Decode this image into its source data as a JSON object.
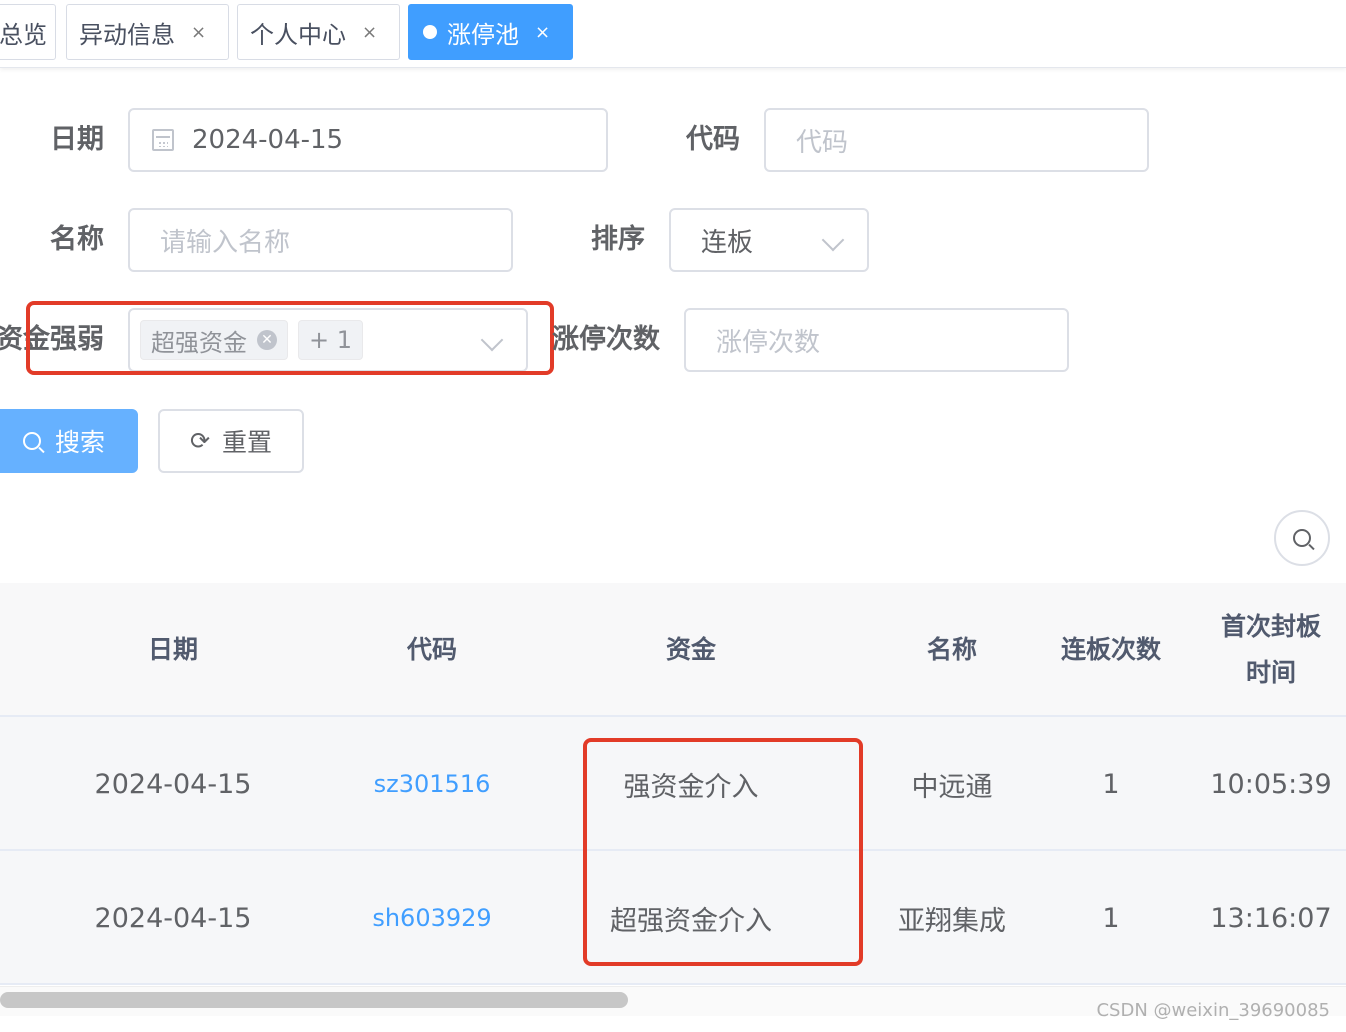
{
  "tabs": [
    {
      "label": "总览",
      "active": false,
      "closable": false
    },
    {
      "label": "异动信息",
      "active": false,
      "closable": true
    },
    {
      "label": "个人中心",
      "active": false,
      "closable": true
    },
    {
      "label": "涨停池",
      "active": true,
      "closable": true
    }
  ],
  "tab_close_glyph": "×",
  "form": {
    "date": {
      "label": "日期",
      "value": "2024-04-15"
    },
    "code": {
      "label": "代码",
      "placeholder": "代码"
    },
    "name": {
      "label": "名称",
      "placeholder": "请输入名称"
    },
    "sort": {
      "label": "排序",
      "value": "连板"
    },
    "capital": {
      "label": "资金强弱",
      "tags": [
        "超强资金",
        "+ 1"
      ]
    },
    "limit_count": {
      "label": "涨停次数",
      "placeholder": "涨停次数"
    }
  },
  "buttons": {
    "search": "搜索",
    "reset": "重置"
  },
  "table": {
    "headers": [
      "日期",
      "代码",
      "资金",
      "名称",
      "连板次数",
      "首次封板\n时间"
    ],
    "rows": [
      {
        "date": "2024-04-15",
        "code": "sz301516",
        "capital": "强资金介入",
        "name": "中远通",
        "boards": "1",
        "first_time": "10:05:39"
      },
      {
        "date": "2024-04-15",
        "code": "sh603929",
        "capital": "超强资金介入",
        "name": "亚翔集成",
        "boards": "1",
        "first_time": "13:16:07"
      }
    ]
  },
  "watermark": "CSDN @weixin_39690085",
  "colors": {
    "primary": "#409eff",
    "highlight": "#e23b28"
  }
}
